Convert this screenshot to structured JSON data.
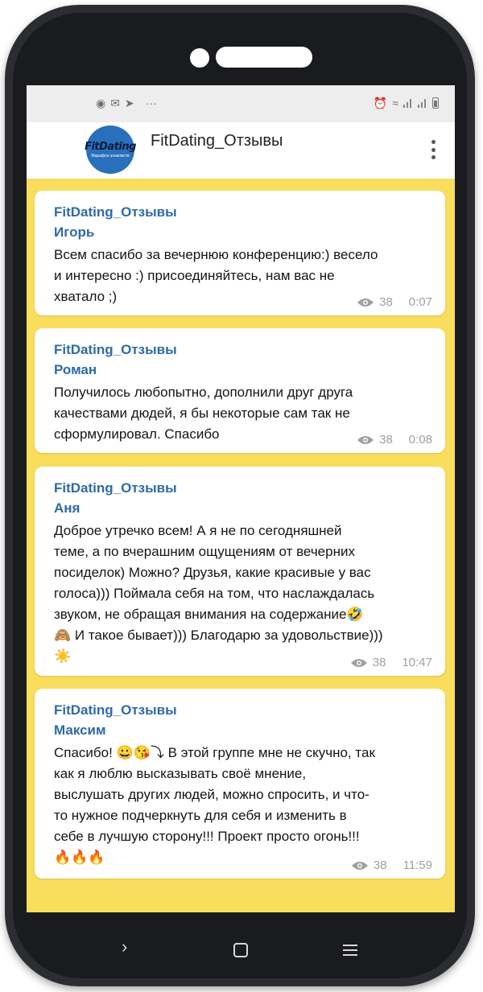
{
  "statusbar": {
    "left_icons": [
      "rss-icon",
      "mail-icon",
      "telegram-icon",
      "more-dots-icon"
    ],
    "left_glyphs": [
      "◉",
      "✉",
      "➤",
      "···"
    ],
    "right_icons": [
      "alarm-icon",
      "wifi-icon",
      "signal-icon",
      "signal-icon",
      "battery-icon"
    ],
    "right_glyphs": [
      "⏰",
      "≈"
    ]
  },
  "header": {
    "title": "FitDating_Отзывы",
    "avatar_logo": "FitDating",
    "avatar_sub": "Марафон знакомств"
  },
  "messages": [
    {
      "channel": "FitDating_Отзывы",
      "author": "Игорь",
      "text": "Всем спасибо за вечернюю конференцию:) весело\nи интересно :) присоединяйтесь, нам вас не\nхватало ;)",
      "views": "38",
      "time": "0:07"
    },
    {
      "channel": "FitDating_Отзывы",
      "author": "Роман",
      "text": "Получилось любопытно, дополнили друг друга\nкачествами дюдей, я бы некоторые сам так не\nсформулировал. Спасибо",
      "views": "38",
      "time": "0:08"
    },
    {
      "channel": "FitDating_Отзывы",
      "author": "Аня",
      "text": "Доброе утречко всем! А я не по сегодняшней\nтеме, а по вчерашним ощущениям от вечерних\nпосиделок) Можно? Друзья, какие красивые у вас\nголоса))) Поймала себя на том, что наслаждалась\nзвуком, не обращая внимания на содержание🤣\n🙈 И такое бывает))) Благодарю за удовольствие)))\n☀️",
      "views": "38",
      "time": "10:47"
    },
    {
      "channel": "FitDating_Отзывы",
      "author": "Максим",
      "text": "Спасибо! 😀😘⤵ В этой группе мне не скучно, так\nкак я люблю высказывать своё мнение,\nвыслушать других людей, можно спросить, и что-\nто нужное подчеркнуть для себя и изменить в\nсебе в лучшую сторону!!! Проект просто огонь!!!\n🔥🔥🔥",
      "views": "38",
      "time": "11:59"
    }
  ],
  "navbar": {
    "back_glyph": "›"
  },
  "colors": {
    "chat_background": "#f9dd5c",
    "accent_name": "#2f6aa6",
    "phone_body": "#1a1b1e"
  }
}
